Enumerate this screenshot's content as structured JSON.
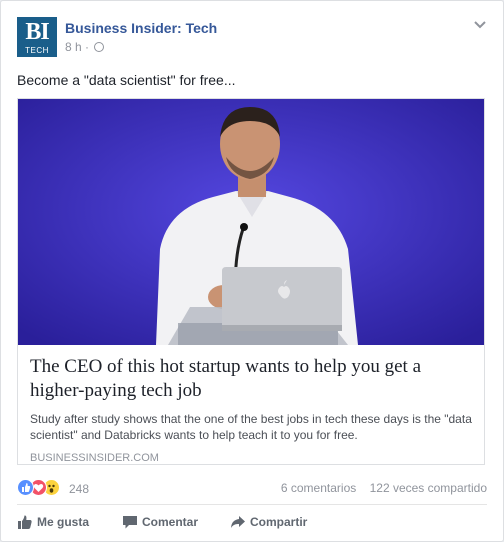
{
  "post": {
    "page_name": "Business Insider: Tech",
    "logo_text": "BI",
    "logo_subtext": "TECH",
    "time": "8 h",
    "separator": "·",
    "status_text": "Become a \"data scientist\" for free..."
  },
  "link": {
    "headline": "The CEO of this hot startup wants to help you get a higher-paying tech job",
    "description": "Study after study shows that the one of the best jobs in tech these days is the \"data scientist\" and Databricks wants to help teach it to you for free.",
    "domain": "BUSINESSINSIDER.COM"
  },
  "stats": {
    "reaction_count": "248",
    "comments": "6 comentarios",
    "shares": "122 veces compartido"
  },
  "actions": {
    "like": "Me gusta",
    "comment": "Comentar",
    "share": "Compartir"
  },
  "colors": {
    "page_name": "#365899",
    "logo_bg": "#1a5e8a",
    "image_bg": "#3b2fb5",
    "like_blue": "#5890ff",
    "love_red": "#f25268",
    "wow_yellow": "#fcd33f"
  }
}
